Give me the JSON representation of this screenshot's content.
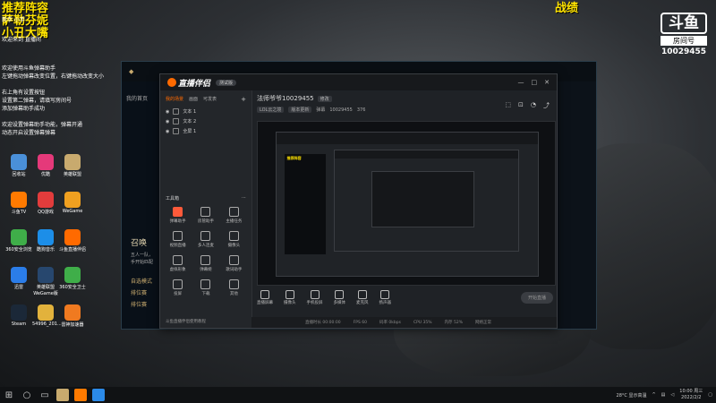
{
  "overlay": {
    "lines": [
      "推荐阵容",
      "萨勒芬妮",
      "小丑大嘴"
    ],
    "right_title": "战绩"
  },
  "douyu": {
    "mark": "斗鱼",
    "sub": "房间号",
    "room": "10029455"
  },
  "chat": {
    "lines": [
      "新手 小手",
      "欢迎来到 直播间",
      "欢迎使用斗鱼弹幕助手",
      "左键拖动弹幕改变位置，右键拖动改变大小",
      "右上角有设置按钮",
      "设置第二弹幕，请填写房间号",
      "添加弹幕助手成功",
      "欢迎设置弹幕助手功能，弹幕开通",
      "动态开启设置弹幕弹幕"
    ]
  },
  "desktop_icons": [
    {
      "label": "回收站",
      "color": "#4a90d9"
    },
    {
      "label": "优酷",
      "color": "#e5397a"
    },
    {
      "label": "英雄联盟",
      "color": "#c8aa6e"
    },
    {
      "label": "斗鱼TV",
      "color": "#ff7a00"
    },
    {
      "label": "QQ游戏",
      "color": "#e23c3c"
    },
    {
      "label": "WeGame",
      "color": "#f0a020"
    },
    {
      "label": "360安全浏览",
      "color": "#3fae49"
    },
    {
      "label": "酷狗音乐",
      "color": "#1c8ee8"
    },
    {
      "label": "斗鱼直播伴侣",
      "color": "#ff6a00"
    },
    {
      "label": "迅雷",
      "color": "#2b7de9"
    },
    {
      "label": "英雄联盟WeGame版",
      "color": "#27476e"
    },
    {
      "label": "360安全卫士",
      "color": "#3fae49"
    },
    {
      "label": "Steam",
      "color": "#1b2838"
    },
    {
      "label": "54996_201...",
      "color": "#e2b23c"
    },
    {
      "label": "雷神加速器",
      "color": "#f07a20"
    }
  ],
  "lol": {
    "summon": "召唤",
    "side_items": [
      "我的首页",
      "五人一队，",
      "手开始匹配",
      "自选模式",
      "排位赛",
      "排位赛"
    ]
  },
  "app": {
    "logo": "直播伴侣",
    "version": "测试版",
    "tabs": [
      "我的场景",
      "画面",
      "可发表"
    ],
    "scenes": [
      "文本 1",
      "文本 2",
      "全屏 1"
    ],
    "tools_title": "工具箱",
    "tools": [
      {
        "label": "弹幕助手",
        "hot": true
      },
      {
        "label": "房管助手",
        "hot": false
      },
      {
        "label": "主播任务",
        "hot": false
      },
      {
        "label": "视频直播",
        "hot": false
      },
      {
        "label": "多人连麦",
        "hot": false
      },
      {
        "label": "摄像头",
        "hot": false
      },
      {
        "label": "虚拟形象",
        "hot": false
      },
      {
        "label": "弹幕姬",
        "hot": false
      },
      {
        "label": "歌词助手",
        "hot": false
      },
      {
        "label": "投屏",
        "hot": false
      },
      {
        "label": "下载",
        "hot": false
      },
      {
        "label": "其他",
        "hot": false
      }
    ],
    "left_foot": "斗鱼直播伴侣使用教程",
    "room_title": "法师爷爷10029455",
    "edit": "修改",
    "room_tags": [
      "LOL云之境",
      "版本更新"
    ],
    "room_extra": [
      "弹幕",
      "10029455",
      "376"
    ],
    "bottom_tools": [
      "直播屏幕",
      "摄像头",
      "手机投屏",
      "多媒体",
      "麦克风",
      "扬声器"
    ],
    "start_live": "开始直播",
    "status": [
      "直播时长 00:00:00",
      "FPS 60",
      "码率 0kbps",
      "CPU 35%",
      "内存 52%",
      "网络正常"
    ]
  },
  "taskbar": {
    "weather": "28°C 显示高温",
    "time": "10:00 周三",
    "date": "2022/2/2"
  }
}
